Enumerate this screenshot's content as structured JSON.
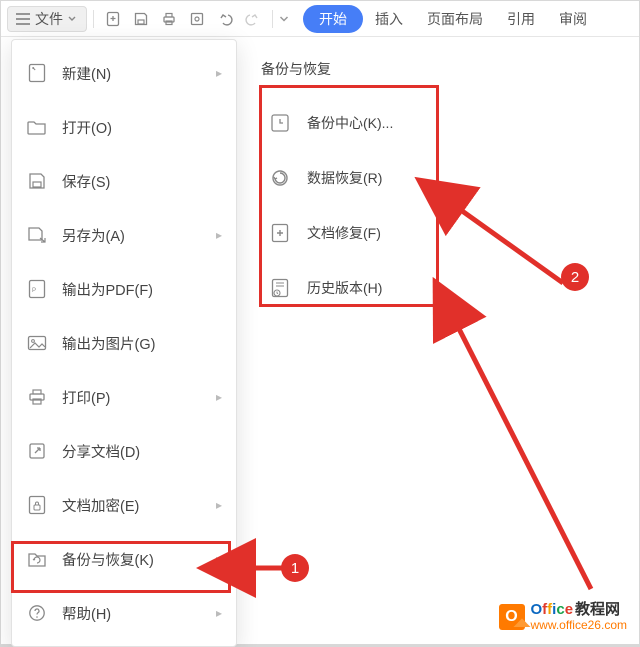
{
  "topbar": {
    "file_label": "文件"
  },
  "tabs": {
    "start": "开始",
    "insert": "插入",
    "layout": "页面布局",
    "reference": "引用",
    "review": "审阅"
  },
  "file_menu": {
    "items": [
      {
        "label": "新建(N)",
        "has_sub": true
      },
      {
        "label": "打开(O)"
      },
      {
        "label": "保存(S)"
      },
      {
        "label": "另存为(A)",
        "has_sub": true
      },
      {
        "label": "输出为PDF(F)"
      },
      {
        "label": "输出为图片(G)"
      },
      {
        "label": "打印(P)",
        "has_sub": true
      },
      {
        "label": "分享文档(D)"
      },
      {
        "label": "文档加密(E)",
        "has_sub": true
      },
      {
        "label": "备份与恢复(K)",
        "has_sub": true
      },
      {
        "label": "帮助(H)",
        "has_sub": true
      }
    ]
  },
  "submenu": {
    "title": "备份与恢复",
    "items": [
      {
        "label": "备份中心(K)..."
      },
      {
        "label": "数据恢复(R)"
      },
      {
        "label": "文档修复(F)"
      },
      {
        "label": "历史版本(H)"
      }
    ]
  },
  "annotations": {
    "badge1": "1",
    "badge2": "2"
  },
  "watermark": {
    "brand_prefix": "Office",
    "brand_suffix": "教程网",
    "url": "www.office26.com"
  },
  "colors": {
    "accent": "#467ef7",
    "annotation": "#e1302a",
    "brand_orange": "#ff7a00"
  }
}
